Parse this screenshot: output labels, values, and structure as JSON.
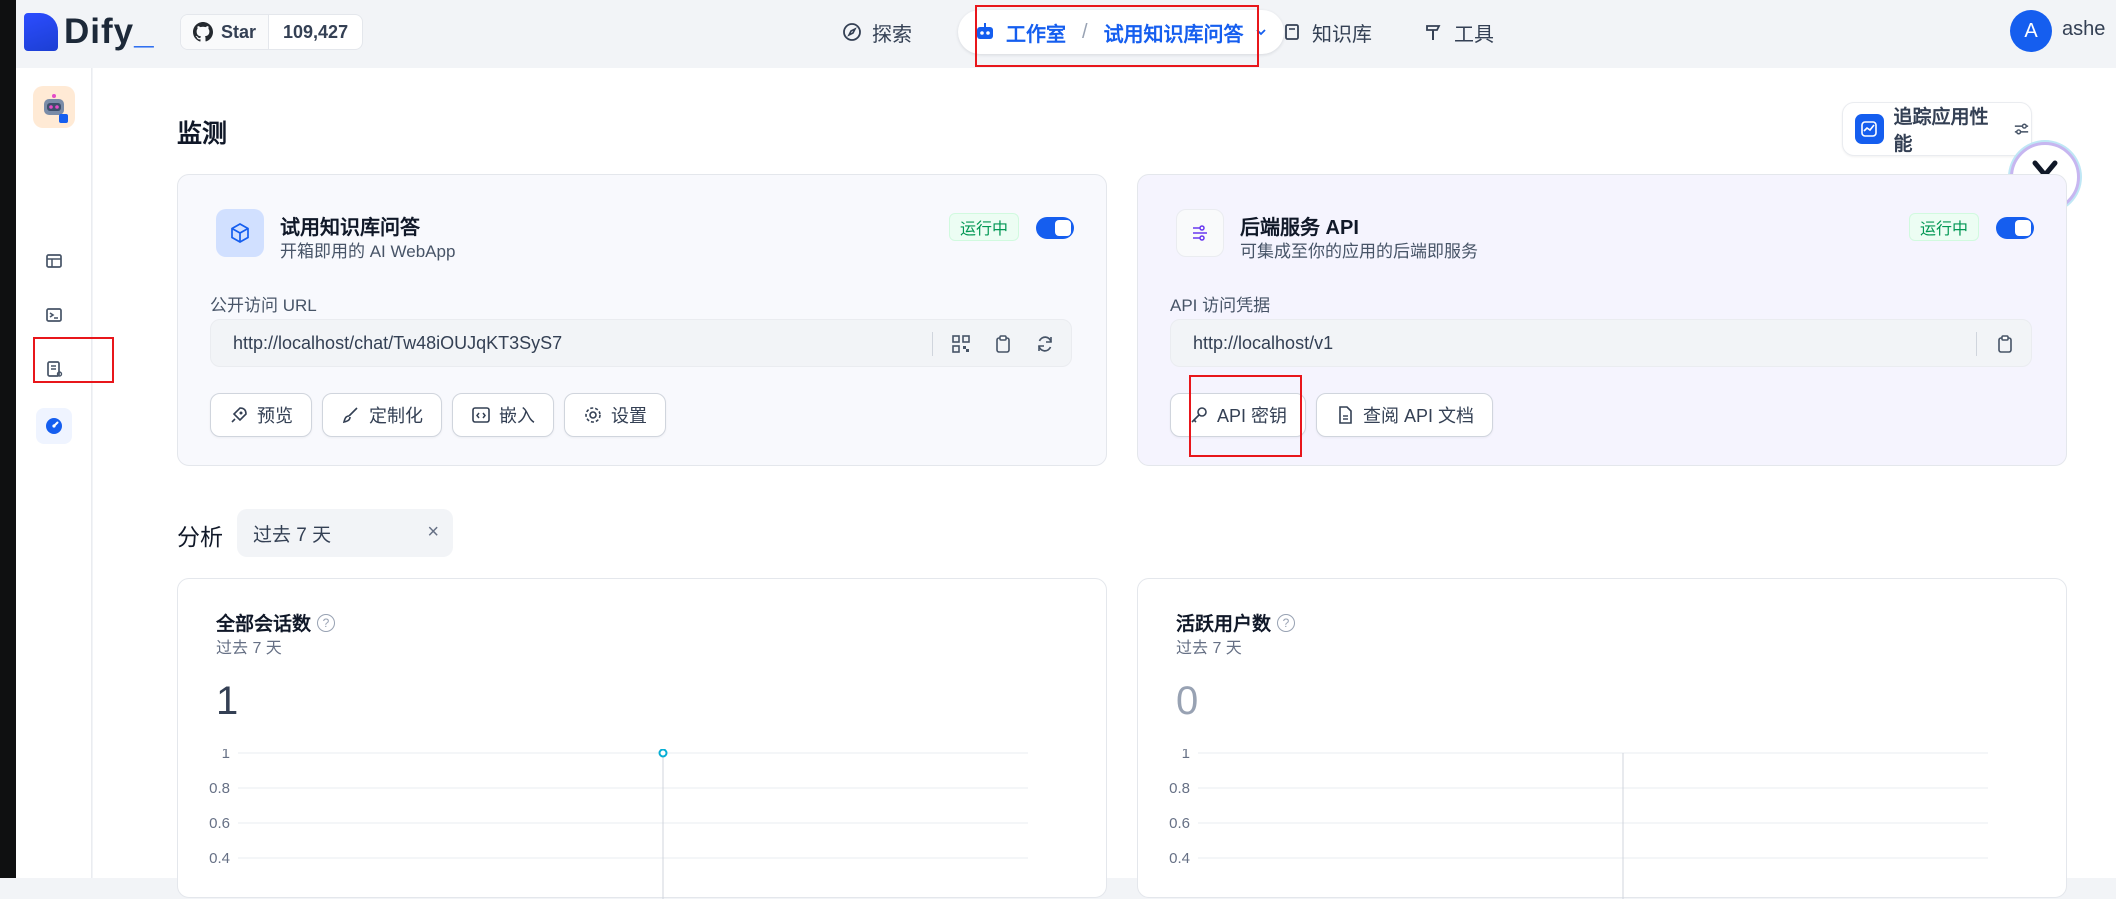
{
  "header": {
    "logo_text": "Dify",
    "github": {
      "star_label": "Star",
      "count": "109,427"
    },
    "nav": {
      "explore": "探索",
      "studio": "工作室",
      "current_app": "试用知识库问答",
      "knowledge": "知识库",
      "tools": "工具"
    },
    "user": {
      "avatar_letter": "A",
      "name": "ashe"
    }
  },
  "page": {
    "title": "监测",
    "trace_button": "追踪应用性能"
  },
  "webapp_card": {
    "title": "试用知识库问答",
    "description": "开箱即用的 AI WebApp",
    "status": "运行中",
    "url_label": "公开访问 URL",
    "url": "http://localhost/chat/Tw48iOUJqKT3SyS7",
    "buttons": {
      "preview": "预览",
      "customize": "定制化",
      "embed": "嵌入",
      "settings": "设置"
    }
  },
  "api_card": {
    "title": "后端服务 API",
    "description": "可集成至你的应用的后端即服务",
    "status": "运行中",
    "url_label": "API 访问凭据",
    "url": "http://localhost/v1",
    "buttons": {
      "api_key": "API 密钥",
      "api_docs": "查阅 API 文档"
    }
  },
  "analysis": {
    "title": "分析",
    "period": "过去 7 天"
  },
  "colors": {
    "accent": "#155eef",
    "status_green": "#039855",
    "annotation_red": "#e8161b"
  },
  "chart_data": [
    {
      "type": "line",
      "title": "全部会话数",
      "subtitle": "过去 7 天",
      "total": "1",
      "y_ticks": [
        "1",
        "0.8",
        "0.6",
        "0.4"
      ],
      "ylim": [
        0,
        1
      ],
      "points": [
        {
          "y": 1
        }
      ],
      "grid": true,
      "color": "#06aed4"
    },
    {
      "type": "line",
      "title": "活跃用户数",
      "subtitle": "过去 7 天",
      "total": "0",
      "y_ticks": [
        "1",
        "0.8",
        "0.6",
        "0.4"
      ],
      "ylim": [
        0,
        1
      ],
      "points": [],
      "grid": true,
      "color": "#98a2b3"
    }
  ]
}
